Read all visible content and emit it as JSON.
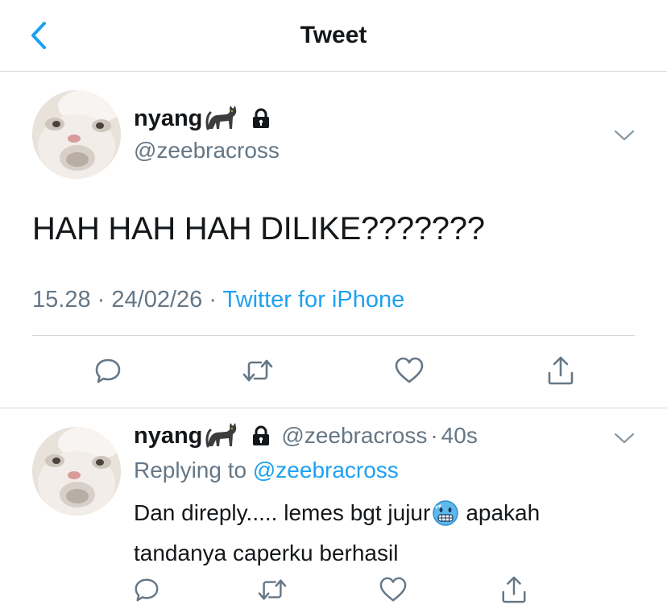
{
  "header": {
    "title": "Tweet",
    "back_icon": "chevron-left-icon"
  },
  "colors": {
    "accent": "#1da1f2",
    "secondary_text": "#657786",
    "primary_text": "#14171a",
    "divider": "#d6d9db"
  },
  "tweet": {
    "display_name": "nyang",
    "name_emoji": "black-cat-emoji",
    "protected_icon": "lock-icon",
    "handle": "@zeebracross",
    "text": "HAH HAH HAH DILIKE???????",
    "time": "15.28",
    "separator": "·",
    "date": "24/02/26",
    "source": "Twitter for iPhone",
    "actions": [
      "reply-icon",
      "retweet-icon",
      "like-icon",
      "share-icon"
    ]
  },
  "reply": {
    "display_name": "nyang",
    "name_emoji": "black-cat-emoji",
    "protected_icon": "lock-icon",
    "handle": "@zeebracross",
    "separator": "·",
    "age": "40s",
    "replying_prefix": "Replying to",
    "replying_to": "@zeebracross",
    "text_before_emoji": "Dan direply..... lemes bgt jujur",
    "text_emoji": "cold-face-emoji",
    "text_after_emoji": "apakah tandanya caperku berhasil",
    "actions": [
      "reply-icon",
      "retweet-icon",
      "like-icon",
      "share-icon"
    ]
  }
}
